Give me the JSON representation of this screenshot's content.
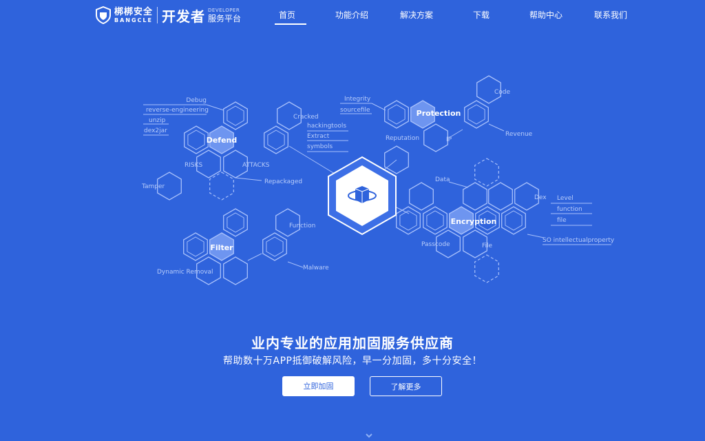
{
  "header": {
    "logo_cn": "梆梆安全",
    "logo_en": "BANGCLE",
    "logo_product": "开发者",
    "logo_developer": "DEVELOPER",
    "logo_platform": "服务平台"
  },
  "nav": {
    "items": [
      "首页",
      "功能介绍",
      "解决方案",
      "下载",
      "帮助中心",
      "联系我们"
    ],
    "active": "首页"
  },
  "diagram": {
    "hubs": [
      "Defend",
      "Protection",
      "Encryption",
      "Filter"
    ],
    "labels": [
      "Debug",
      "reverse-engineering",
      "unzip",
      "dex2jar",
      "RISKS",
      "ATTACKS",
      "Tamper",
      "Repackaged",
      "Cracked",
      "hackingtools",
      "Extract",
      "symbols",
      "Integrity",
      "sourcefile",
      "Reputation",
      "IP",
      "Code",
      "Revenue",
      "Data",
      "Dex",
      "Level",
      "function",
      "file",
      "SO intellectualproperty",
      "Passcode",
      "File",
      "Function",
      "Malware",
      "Dynamic Removal"
    ]
  },
  "hero": {
    "title": "业内专业的应用加固服务供应商",
    "subtitle": "帮助数十万APP抵御破解风险，早一分加固，多十分安全！",
    "primary_button": "立即加固",
    "secondary_button": "了解更多"
  },
  "colors": {
    "background": "#2f63dc",
    "line": "#a9c1fb",
    "hub_fill": "#6e95f0"
  },
  "icons": {
    "logo": "shield-logo-icon",
    "center": "app-shield-icon",
    "scroll": "scroll-down-icon"
  }
}
